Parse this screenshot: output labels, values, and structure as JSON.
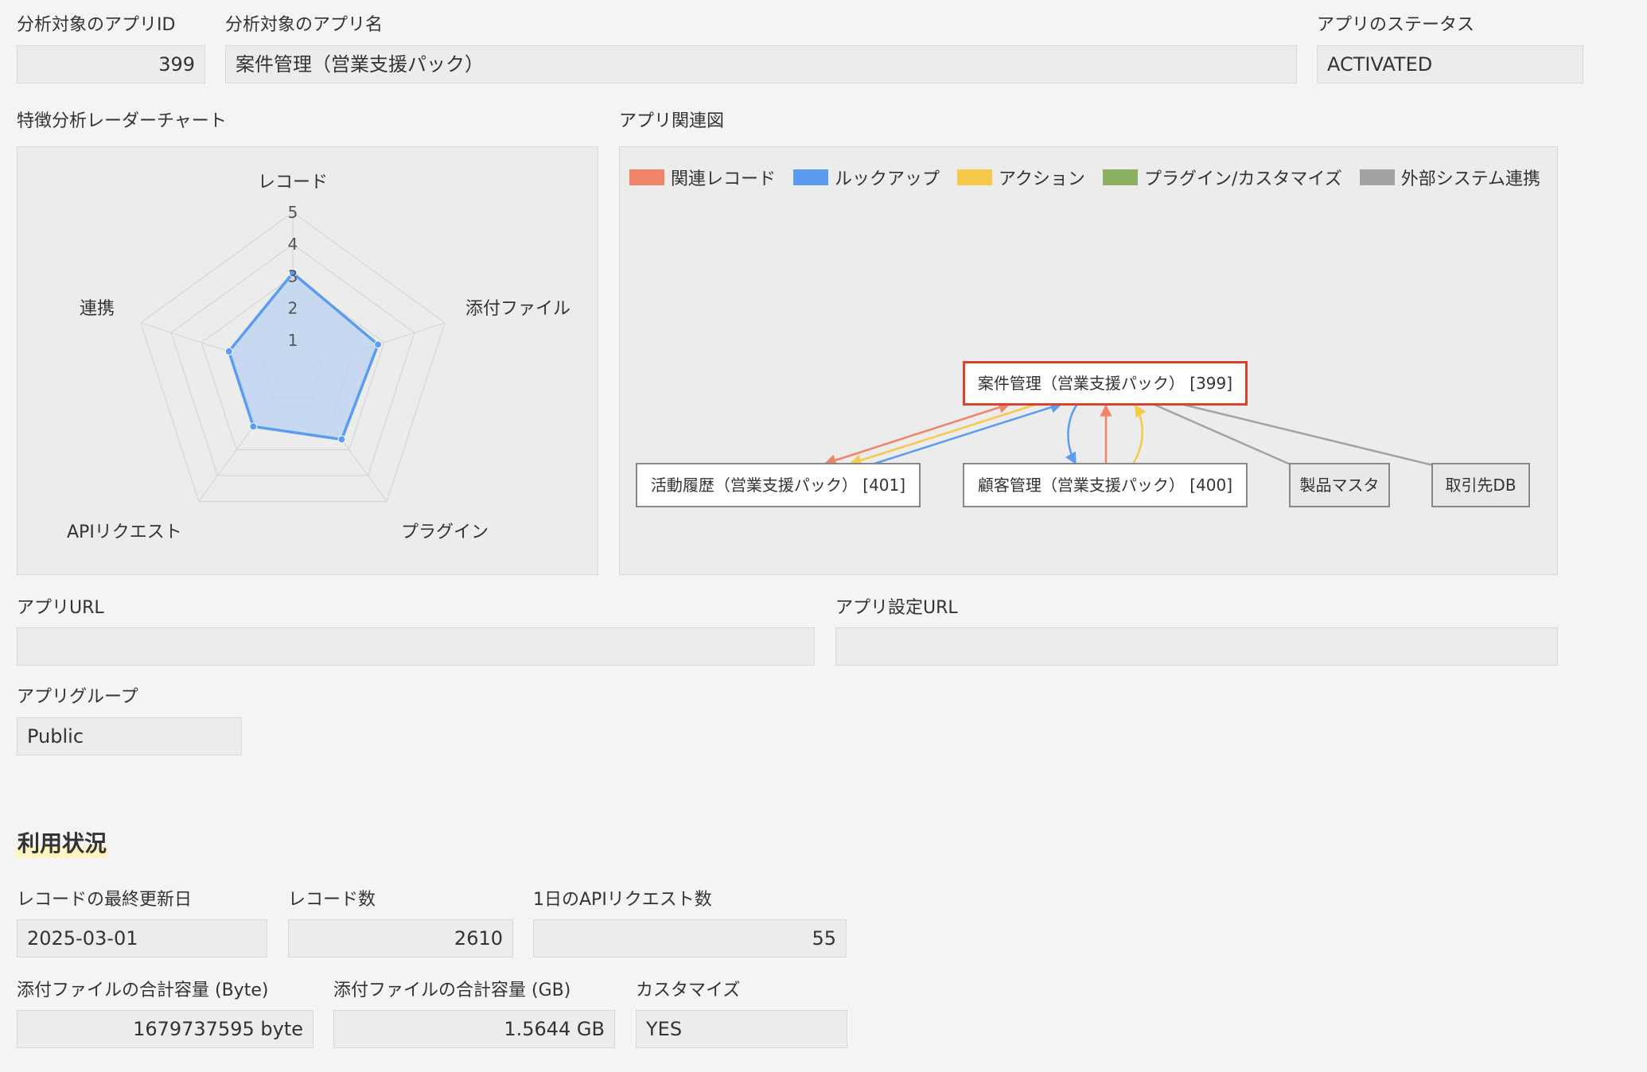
{
  "app_id": {
    "label": "分析対象のアプリID",
    "value": "399"
  },
  "app_name": {
    "label": "分析対象のアプリ名",
    "value": "案件管理（営業支援パック）"
  },
  "app_status": {
    "label": "アプリのステータス",
    "value": "ACTIVATED"
  },
  "radar": {
    "title": "特徴分析レーダーチャート",
    "axes": [
      "レコード",
      "添付ファイル",
      "プラグイン",
      "APIリクエスト",
      "連携"
    ],
    "ticks": [
      "1",
      "2",
      "3",
      "4",
      "5"
    ],
    "max": 5,
    "values": [
      3.1,
      2.8,
      2.6,
      2.1,
      2.1
    ],
    "fill_color": "#b9d3f3",
    "line_color": "#5b9cf0"
  },
  "relation": {
    "title": "アプリ関連図",
    "legend": [
      {
        "label": "関連レコード",
        "color": "#f08466"
      },
      {
        "label": "ルックアップ",
        "color": "#5b9cf0"
      },
      {
        "label": "アクション",
        "color": "#f6c94a"
      },
      {
        "label": "プラグイン/カスタマイズ",
        "color": "#8bb060"
      },
      {
        "label": "外部システム連携",
        "color": "#a3a3a3"
      }
    ],
    "nodes": {
      "main": "案件管理（営業支援パック） [399]",
      "activity": "活動履歴（営業支援パック） [401]",
      "customer": "顧客管理（営業支援パック） [400]",
      "product": "製品マスタ",
      "partner": "取引先DB"
    }
  },
  "app_url": {
    "label": "アプリURL",
    "value": ""
  },
  "app_setting_url": {
    "label": "アプリ設定URL",
    "value": ""
  },
  "app_group": {
    "label": "アプリグループ",
    "value": "Public"
  },
  "usage": {
    "title": "利用状況",
    "last_updated": {
      "label": "レコードの最終更新日",
      "value": "2025-03-01"
    },
    "record_count": {
      "label": "レコード数",
      "value": "2610"
    },
    "api_requests": {
      "label": "1日のAPIリクエスト数",
      "value": "55"
    },
    "attach_bytes": {
      "label": "添付ファイルの合計容量 (Byte)",
      "value": "1679737595 byte"
    },
    "attach_gb": {
      "label": "添付ファイルの合計容量 (GB)",
      "value": "1.5644 GB"
    },
    "customize": {
      "label": "カスタマイズ",
      "value": "YES"
    }
  }
}
